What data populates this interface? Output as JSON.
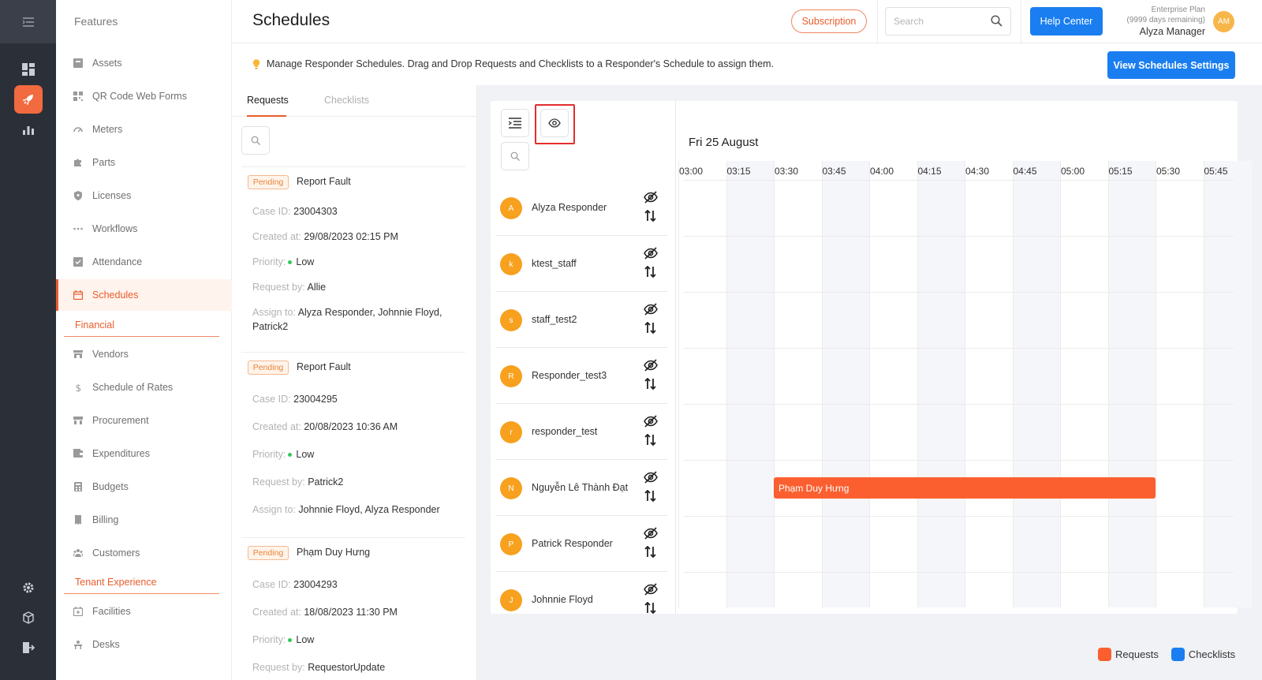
{
  "sidebar": {
    "title": "Features",
    "items": [
      {
        "label": "Assets",
        "icon": "assets-icon"
      },
      {
        "label": "QR Code Web Forms",
        "icon": "qr-code-icon"
      },
      {
        "label": "Meters",
        "icon": "gauge-icon"
      },
      {
        "label": "Parts",
        "icon": "puzzle-icon"
      },
      {
        "label": "Licenses",
        "icon": "shield-icon"
      },
      {
        "label": "Workflows",
        "icon": "dots-icon"
      },
      {
        "label": "Attendance",
        "icon": "check-box-icon"
      },
      {
        "label": "Schedules",
        "icon": "calendar-icon",
        "active": true
      },
      {
        "label": "Vendors",
        "icon": "store-icon"
      },
      {
        "label": "Schedule of Rates",
        "icon": "dollar-icon"
      },
      {
        "label": "Procurement",
        "icon": "procurement-icon"
      },
      {
        "label": "Expenditures",
        "icon": "wallet-icon"
      },
      {
        "label": "Budgets",
        "icon": "calculator-icon"
      },
      {
        "label": "Billing",
        "icon": "receipt-icon"
      },
      {
        "label": "Customers",
        "icon": "users-icon"
      },
      {
        "label": "Facilities",
        "icon": "facility-icon"
      },
      {
        "label": "Desks",
        "icon": "desk-icon"
      }
    ],
    "sections": [
      "Financial",
      "Tenant Experience"
    ]
  },
  "header": {
    "title": "Schedules",
    "subscription_label": "Subscription",
    "search_placeholder": "Search",
    "help_label": "Help Center",
    "plan_name": "Enterprise Plan",
    "plan_remaining": "(9999 days remaining)",
    "user_name": "Alyza Manager",
    "user_initials": "AM"
  },
  "info": {
    "message": "Manage Responder Schedules. Drag and Drop Requests and Checklists to a Responder's Schedule to assign them.",
    "settings_label": "View Schedules Settings"
  },
  "requests_panel": {
    "tabs": [
      "Requests",
      "Checklists"
    ],
    "labels": {
      "case_id": "Case ID:",
      "created_at": "Created at:",
      "priority": "Priority:",
      "request_by": "Request by:",
      "assign_to": "Assign to:"
    },
    "cards": [
      {
        "status": "Pending",
        "title": "Report Fault",
        "case_id": "23004303",
        "created_at": "29/08/2023 02:15 PM",
        "priority": "Low",
        "request_by": "Allie",
        "assign_to": "Alyza Responder, Johnnie Floyd, Patrick2"
      },
      {
        "status": "Pending",
        "title": "Report Fault",
        "case_id": "23004295",
        "created_at": "20/08/2023 10:36 AM",
        "priority": "Low",
        "request_by": "Patrick2",
        "assign_to": "Johnnie Floyd, Alyza Responder"
      },
      {
        "status": "Pending",
        "title": "Phạm Duy Hưng",
        "case_id": "23004293",
        "created_at": "18/08/2023 11:30 PM",
        "priority": "Low",
        "request_by": "RequestorUpdate",
        "assign_to": ""
      }
    ]
  },
  "schedule": {
    "date": "Fri 25 August",
    "times": [
      "03:00",
      "03:15",
      "03:30",
      "03:45",
      "04:00",
      "04:15",
      "04:30",
      "04:45",
      "05:00",
      "05:15",
      "05:30",
      "05:45"
    ],
    "responders": [
      {
        "initial": "A",
        "name": "Alyza Responder"
      },
      {
        "initial": "k",
        "name": "ktest_staff"
      },
      {
        "initial": "s",
        "name": "staff_test2"
      },
      {
        "initial": "R",
        "name": "Responder_test3"
      },
      {
        "initial": "r",
        "name": "responder_test"
      },
      {
        "initial": "N",
        "name": "Nguyễn Lê Thành Đạt"
      },
      {
        "initial": "P",
        "name": "Patrick Responder"
      },
      {
        "initial": "J",
        "name": "Johnnie Floyd"
      }
    ],
    "event": {
      "label": "Phạm Duy Hưng",
      "responder": "Nguyễn Lê Thành Đạt",
      "start": "03:30",
      "end": "05:30",
      "color": "#fb5f30"
    }
  },
  "legend": [
    {
      "label": "Requests",
      "color": "#fb5f30"
    },
    {
      "label": "Checklists",
      "color": "#1a7ef0"
    }
  ],
  "colors": {
    "accent": "#e85d2c",
    "primary": "#1a7ef0",
    "rail": "#2b2f38"
  }
}
